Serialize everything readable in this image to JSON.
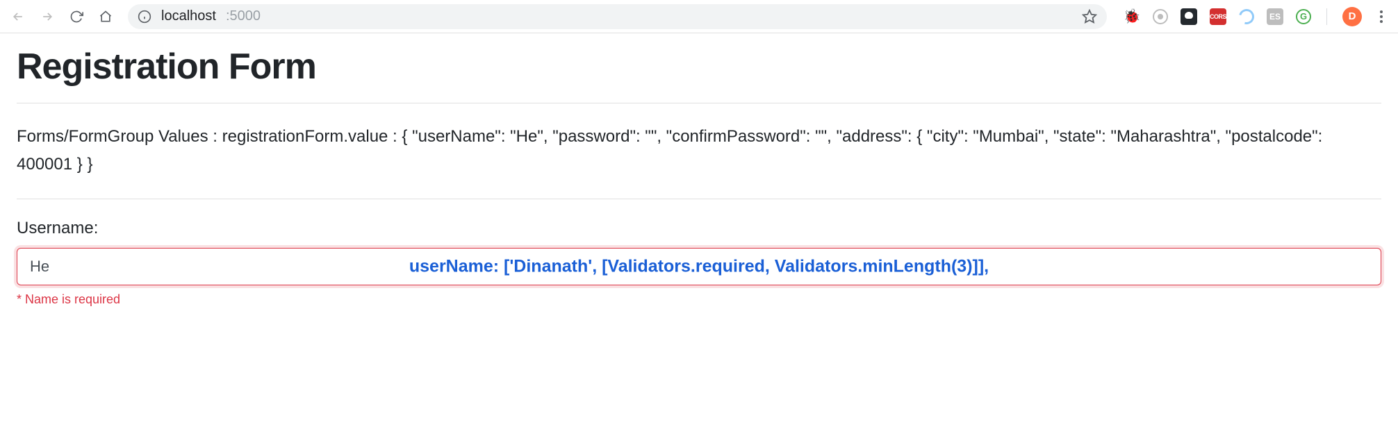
{
  "toolbar": {
    "url_host": "localhost",
    "url_port": ":5000",
    "extensions": {
      "cors": "CORS",
      "es": "ES",
      "g": "G"
    },
    "avatar_initial": "D"
  },
  "page": {
    "title": "Registration Form",
    "form_values_text": "Forms/FormGroup Values : registrationForm.value : { \"userName\": \"He\", \"password\": \"\", \"confirmPassword\": \"\", \"address\": { \"city\": \"Mumbai\", \"state\": \"Maharashtra\", \"postalcode\": 400001 } }",
    "username_label": "Username:",
    "username_value": "He",
    "overlay_code": "userName: ['Dinanath', [Validators.required, Validators.minLength(3)]],",
    "error_message": "* Name is required"
  }
}
